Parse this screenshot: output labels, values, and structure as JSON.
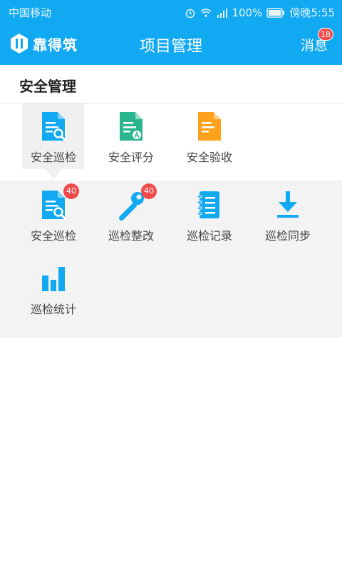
{
  "status_bar": {
    "carrier": "中国移动",
    "battery": "100%",
    "time": "傍晚5:55"
  },
  "app_bar": {
    "logo_text": "靠得筑",
    "title": "项目管理",
    "messages_label": "消息",
    "messages_count": "18"
  },
  "section": {
    "title": "安全管理"
  },
  "top_items": [
    {
      "label": "安全巡检",
      "icon": "doc-search-icon",
      "color": "#11a9f2"
    },
    {
      "label": "安全评分",
      "icon": "doc-score-icon",
      "color": "#2bb58e"
    },
    {
      "label": "安全验收",
      "icon": "doc-accept-icon",
      "color": "#ffa11a"
    }
  ],
  "sub_items": [
    {
      "label": "安全巡检",
      "icon": "doc-search-icon",
      "badge": "40",
      "color": "#11a9f2"
    },
    {
      "label": "巡检整改",
      "icon": "wrench-icon",
      "badge": "40",
      "color": "#11a9f2"
    },
    {
      "label": "巡检记录",
      "icon": "notebook-icon",
      "color": "#11a9f2"
    },
    {
      "label": "巡检同步",
      "icon": "download-icon",
      "color": "#11a9f2"
    },
    {
      "label": "巡检统计",
      "icon": "bar-chart-icon",
      "color": "#11a9f2"
    }
  ],
  "colors": {
    "brand": "#11a9f2",
    "badge": "#f24b4b",
    "panel_bg": "#f3f3f3"
  }
}
